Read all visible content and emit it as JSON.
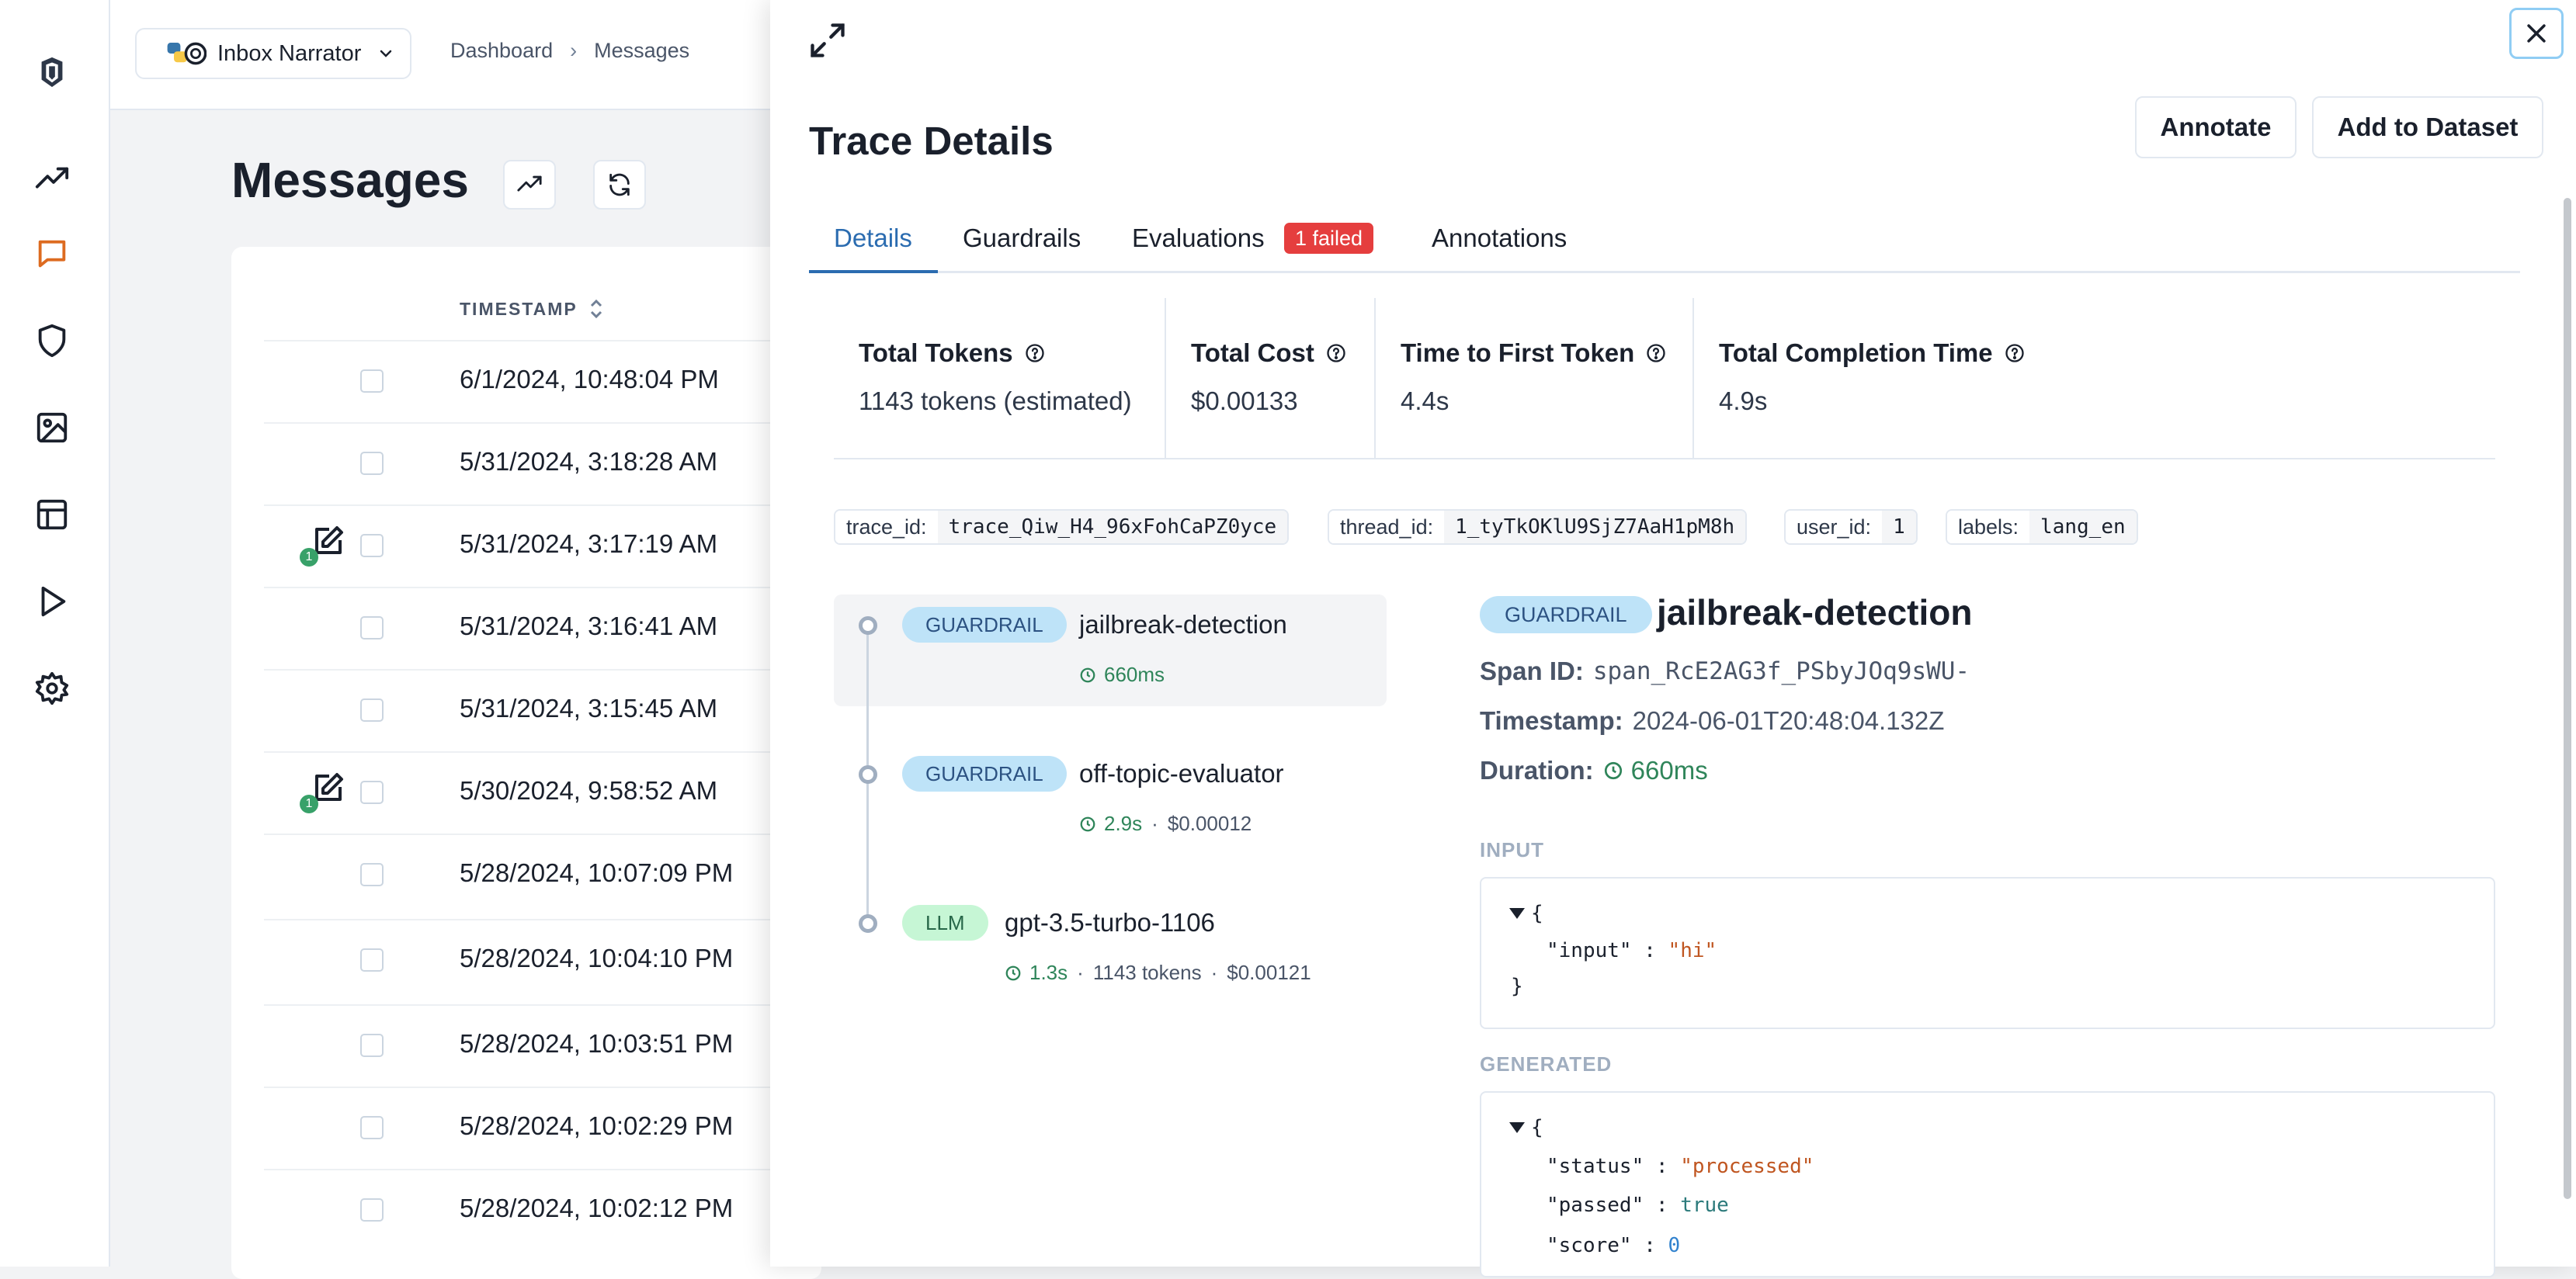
{
  "project": {
    "name": "Inbox Narrator"
  },
  "breadcrumb": {
    "items": [
      "Dashboard",
      "Messages"
    ],
    "separator": "›"
  },
  "page": {
    "title": "Messages"
  },
  "table": {
    "column_header": "TIMESTAMP",
    "rows": [
      {
        "timestamp": "6/1/2024, 10:48:04 PM",
        "annotations": ""
      },
      {
        "timestamp": "5/31/2024, 3:18:28 AM",
        "annotations": ""
      },
      {
        "timestamp": "5/31/2024, 3:17:19 AM",
        "annotations": "1"
      },
      {
        "timestamp": "5/31/2024, 3:16:41 AM",
        "annotations": ""
      },
      {
        "timestamp": "5/31/2024, 3:15:45 AM",
        "annotations": ""
      },
      {
        "timestamp": "5/30/2024, 9:58:52 AM",
        "annotations": "1"
      },
      {
        "timestamp": "5/28/2024, 10:07:09 PM",
        "annotations": ""
      },
      {
        "timestamp": "5/28/2024, 10:04:10 PM",
        "annotations": ""
      },
      {
        "timestamp": "5/28/2024, 10:03:51 PM",
        "annotations": ""
      },
      {
        "timestamp": "5/28/2024, 10:02:29 PM",
        "annotations": ""
      },
      {
        "timestamp": "5/28/2024, 10:02:12 PM",
        "annotations": ""
      }
    ]
  },
  "drawer": {
    "title": "Trace Details",
    "annotate_label": "Annotate",
    "add_dataset_label": "Add to Dataset",
    "tabs": [
      {
        "label": "Details",
        "active": true
      },
      {
        "label": "Guardrails"
      },
      {
        "label": "Evaluations",
        "badge": "1 failed"
      },
      {
        "label": "Annotations"
      }
    ],
    "metrics": [
      {
        "label": "Total Tokens",
        "value": "1143 tokens (estimated)"
      },
      {
        "label": "Total Cost",
        "value": "$0.00133"
      },
      {
        "label": "Time to First Token",
        "value": "4.4s"
      },
      {
        "label": "Total Completion Time",
        "value": "4.9s"
      }
    ],
    "tags": [
      {
        "key": "trace_id:",
        "value": "trace_Qiw_H4_96xFohCaPZ0yce"
      },
      {
        "key": "thread_id:",
        "value": "1_tyTkOKlU9SjZ7AaH1pM8h"
      },
      {
        "key": "user_id:",
        "value": "1"
      },
      {
        "key": "labels:",
        "value": "lang_en"
      }
    ],
    "spans": [
      {
        "type": "GUARDRAIL",
        "name": "jailbreak-detection",
        "duration": "660ms",
        "cost": "",
        "tokens": ""
      },
      {
        "type": "GUARDRAIL",
        "name": "off-topic-evaluator",
        "duration": "2.9s",
        "cost": "$0.00012",
        "tokens": ""
      },
      {
        "type": "LLM",
        "name": "gpt-3.5-turbo-1106",
        "duration": "1.3s",
        "tokens": "1143 tokens",
        "cost": "$0.00121"
      }
    ],
    "meta_separator": "·",
    "detail": {
      "type": "GUARDRAIL",
      "name": "jailbreak-detection",
      "span_id_label": "Span ID:",
      "span_id": "span_RcE2AG3f_PSbyJOq9sWU-",
      "timestamp_label": "Timestamp:",
      "timestamp": "2024-06-01T20:48:04.132Z",
      "duration_label": "Duration:",
      "duration": "660ms",
      "input_label": "INPUT",
      "input": {
        "key": "\"input\"",
        "value": "\"hi\""
      },
      "generated_label": "GENERATED",
      "generated": [
        {
          "key": "\"status\"",
          "value": "\"processed\""
        },
        {
          "key": "\"passed\"",
          "value": "true"
        },
        {
          "key": "\"score\"",
          "value": "0"
        }
      ]
    }
  },
  "colors": {
    "accent": "#2b6cb0",
    "guardrail": "#bee3f8",
    "llm": "#c6f6d5",
    "failed": "#e53e3e",
    "active_nav": "#dd6b20"
  },
  "icons": [
    "logo-icon",
    "analytics-icon",
    "messages-icon",
    "shield-icon",
    "image-icon",
    "table-icon",
    "play-icon",
    "gear-icon",
    "expand-icon",
    "close-icon",
    "refresh-icon",
    "trend-icon",
    "sort-icon",
    "help-icon",
    "clock-icon",
    "annotation-icon",
    "chevron-down-icon"
  ]
}
